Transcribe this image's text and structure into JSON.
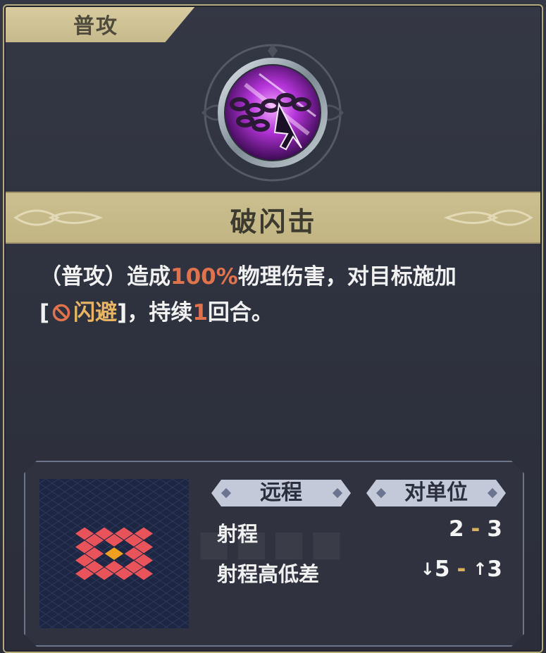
{
  "skill": {
    "type": "普攻",
    "name": "破闪击",
    "icon": "chain-arrow-skill-icon"
  },
  "description": {
    "line1_prefix": "（普攻）造成",
    "damage_percent": "100%",
    "line1_suffix": "物理伤害，对目标施加",
    "bracket_open": "[",
    "status_icon": "no-entry-icon",
    "status_name": "闪避",
    "bracket_close": "]",
    "duration_prefix": "，持续",
    "duration_value": "1",
    "duration_suffix": "回合。"
  },
  "stats": {
    "range_type": "远程",
    "target_type": "对单位",
    "range_label": "射程",
    "range_min": "2",
    "range_dash": "-",
    "range_max": "3",
    "height_label": "射程高低差",
    "height_down_icon": "arrow-down-icon",
    "height_down": "5",
    "height_dash": "-",
    "height_up_icon": "arrow-up-icon",
    "height_up": "3"
  },
  "colors": {
    "highlight": "#e0734b",
    "status": "#e8b565",
    "range_tile": "#e8545a",
    "center_tile": "#f0a020",
    "grid_bg": "#1d2643"
  }
}
